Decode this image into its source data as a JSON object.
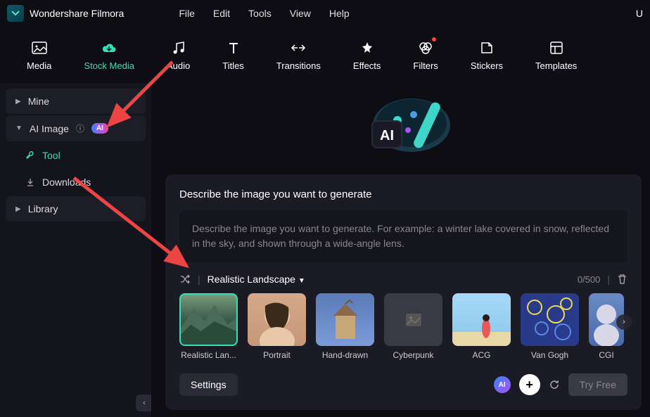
{
  "app": {
    "title": "Wondershare Filmora"
  },
  "menu": [
    "File",
    "Edit",
    "Tools",
    "View",
    "Help"
  ],
  "tabs": [
    {
      "label": "Media"
    },
    {
      "label": "Stock Media"
    },
    {
      "label": "Audio"
    },
    {
      "label": "Titles"
    },
    {
      "label": "Transitions"
    },
    {
      "label": "Effects"
    },
    {
      "label": "Filters"
    },
    {
      "label": "Stickers"
    },
    {
      "label": "Templates"
    }
  ],
  "sidebar": {
    "mine": "Mine",
    "ai_image": "AI Image",
    "ai_badge": "AI",
    "tool": "Tool",
    "downloads": "Downloads",
    "library": "Library"
  },
  "panel": {
    "title": "Describe the image you want to generate",
    "placeholder": "Describe the image you want to generate. For example: a winter lake covered in snow, reflected in the sky, and shown through a wide-angle lens.",
    "style_selected": "Realistic Landscape",
    "char_count": "0/500",
    "styles": [
      "Realistic Lan...",
      "Portrait",
      "Hand-drawn",
      "Cyberpunk",
      "ACG",
      "Van Gogh",
      "CGI"
    ],
    "settings": "Settings",
    "try_free": "Try Free"
  }
}
